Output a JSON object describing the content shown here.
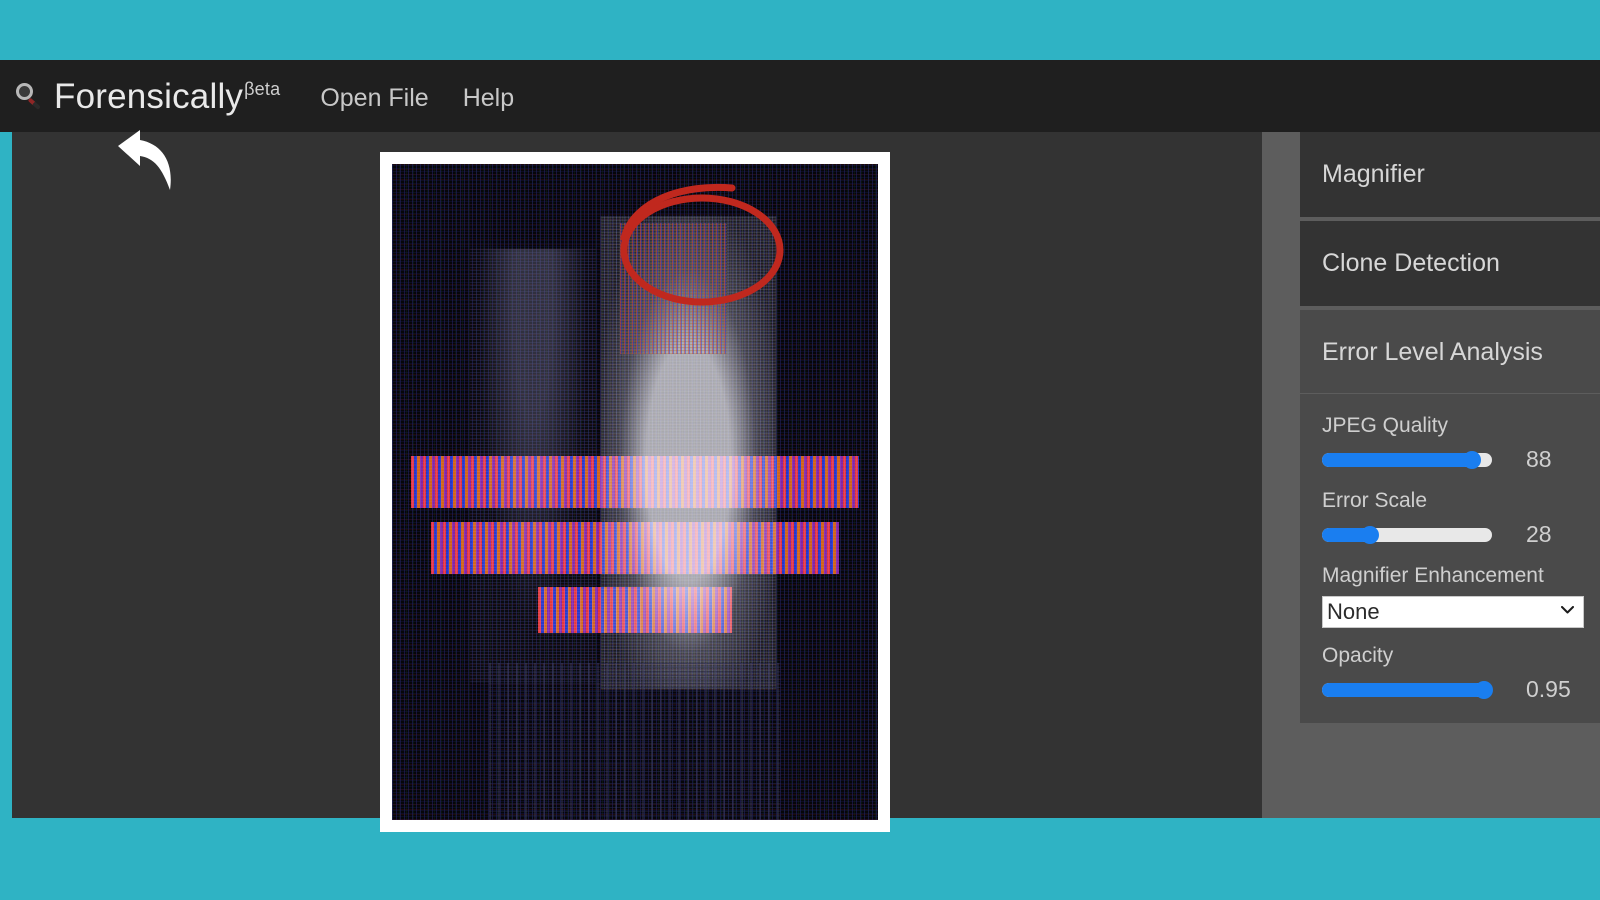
{
  "window": {
    "accent_teal": "#2fb3c4",
    "header_bg": "#1f1f1f",
    "canvas_bg": "#333333",
    "panel_bg": "#5d5d5d",
    "slider_blue": "#1a7ef0",
    "annotation_red": "#c0281e"
  },
  "header": {
    "logo_icon": "magnifier-icon",
    "brand": "Forensically",
    "brand_suffix": "βeta",
    "menu": [
      {
        "label": "Open File",
        "name": "menu-open-file"
      },
      {
        "label": "Help",
        "name": "menu-help"
      }
    ]
  },
  "canvas": {
    "annotations": [
      {
        "type": "back-arrow",
        "name": "back-arrow-annotation",
        "color": "#ffffff"
      },
      {
        "type": "ellipse",
        "name": "red-ellipse-annotation",
        "color": "#c0281e"
      }
    ],
    "image": {
      "name": "ela-result-image",
      "description": "Error Level Analysis noise render of a photo with two figures and a text banner"
    }
  },
  "panel": {
    "tools": [
      {
        "name": "tool-magnifier",
        "label": "Magnifier",
        "active": false
      },
      {
        "name": "tool-clone-detection",
        "label": "Clone Detection",
        "active": false
      },
      {
        "name": "tool-error-level-analysis",
        "label": "Error Level Analysis",
        "active": true
      }
    ],
    "controls": [
      {
        "name": "jpeg-quality",
        "label": "JPEG Quality",
        "type": "slider",
        "value": "88",
        "percent": 88
      },
      {
        "name": "error-scale",
        "label": "Error Scale",
        "type": "slider",
        "value": "28",
        "percent": 28
      },
      {
        "name": "magnifier-enhancement",
        "label": "Magnifier Enhancement",
        "type": "select",
        "value": "None",
        "options": [
          "None"
        ]
      },
      {
        "name": "opacity",
        "label": "Opacity",
        "type": "slider",
        "value": "0.95",
        "percent": 95
      }
    ]
  }
}
